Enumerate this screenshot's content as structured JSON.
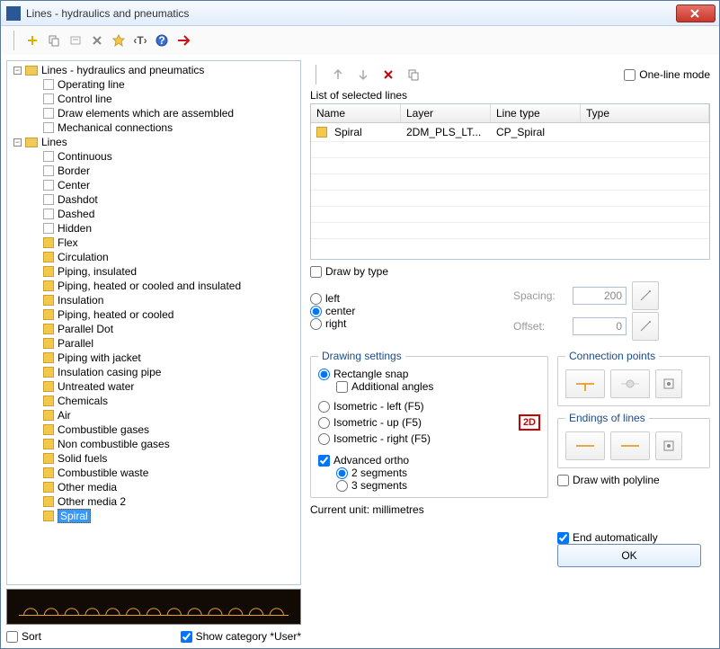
{
  "title": "Lines - hydraulics and pneumatics",
  "toolbar": {
    "oneline": "One-line mode"
  },
  "tree": {
    "root1": "Lines - hydraulics and pneumatics",
    "r1_items": [
      "Operating line",
      "Control line",
      "Draw elements which are assembled",
      "Mechanical connections"
    ],
    "root2": "Lines",
    "r2_items": [
      "Continuous",
      "Border",
      "Center",
      "Dashdot",
      "Dashed",
      "Hidden",
      "Flex",
      "Circulation",
      "Piping, insulated",
      "Piping, heated or cooled and insulated",
      "Insulation",
      "Piping, heated or cooled",
      "Parallel Dot",
      "Parallel",
      "Piping with jacket",
      "Insulation casing pipe",
      "Untreated water",
      "Chemicals",
      "Air",
      "Combustible gases",
      "Non combustible gases",
      "Solid fuels",
      "Combustible waste",
      "Other media",
      "Other media 2",
      "Spiral"
    ],
    "selected": "Spiral"
  },
  "sort": "Sort",
  "showcat": "Show category *User*",
  "right": {
    "listlabel": "List of selected lines",
    "headers": [
      "Name",
      "Layer",
      "Line type",
      "Type"
    ],
    "row": {
      "name": "Spiral",
      "layer": "2DM_PLS_LT...",
      "linetype": "CP_Spiral",
      "type": ""
    },
    "drawbytype": "Draw by type",
    "left": "left",
    "center": "center",
    "right_": "right",
    "spacing": "Spacing:",
    "spacing_v": "200",
    "offset": "Offset:",
    "offset_v": "0",
    "drawset": "Drawing settings",
    "rectsnap": "Rectangle snap",
    "addang": "Additional angles",
    "isoL": "Isometric - left (F5)",
    "isoU": "Isometric - up (F5)",
    "isoR": "Isometric - right (F5)",
    "advortho": "Advanced ortho",
    "seg2": "2 segments",
    "seg3": "3 segments",
    "connpts": "Connection points",
    "endlines": "Endings of lines",
    "drawpoly": "Draw with polyline",
    "unit": "Current unit: millimetres",
    "endauto": "End automatically",
    "ok": "OK"
  }
}
